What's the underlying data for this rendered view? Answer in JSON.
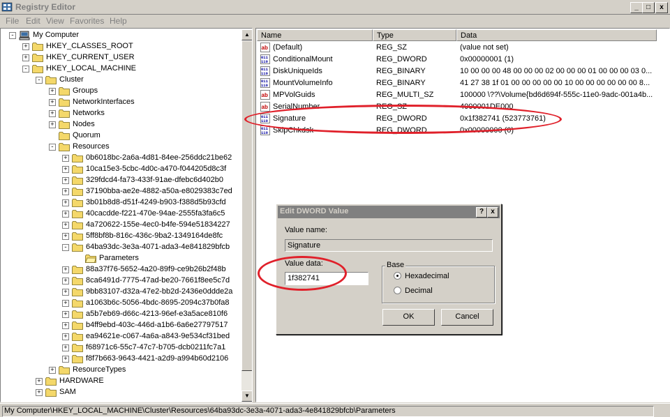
{
  "window": {
    "title": "Registry Editor",
    "min": "_",
    "max": "□",
    "close": "x"
  },
  "menu": [
    "File",
    "Edit",
    "View",
    "Favorites",
    "Help"
  ],
  "tree": [
    {
      "label": "My Computer",
      "level": 0,
      "exp": "-",
      "icon": "computer-icon"
    },
    {
      "label": "HKEY_CLASSES_ROOT",
      "level": 1,
      "exp": "+"
    },
    {
      "label": "HKEY_CURRENT_USER",
      "level": 1,
      "exp": "+"
    },
    {
      "label": "HKEY_LOCAL_MACHINE",
      "level": 1,
      "exp": "-"
    },
    {
      "label": "Cluster",
      "level": 2,
      "exp": "-"
    },
    {
      "label": "Groups",
      "level": 3,
      "exp": "+"
    },
    {
      "label": "NetworkInterfaces",
      "level": 3,
      "exp": "+"
    },
    {
      "label": "Networks",
      "level": 3,
      "exp": "+"
    },
    {
      "label": "Nodes",
      "level": 3,
      "exp": "+"
    },
    {
      "label": "Quorum",
      "level": 3,
      "exp": ""
    },
    {
      "label": "Resources",
      "level": 3,
      "exp": "-"
    },
    {
      "label": "0b6018bc-2a6a-4d81-84ee-256ddc21be62",
      "level": 4,
      "exp": "+"
    },
    {
      "label": "10ca15e3-5cbc-4d0c-a470-f044205d8c3f",
      "level": 4,
      "exp": "+"
    },
    {
      "label": "329fdcd4-fa73-433f-91ae-dfebc6d402b0",
      "level": 4,
      "exp": "+"
    },
    {
      "label": "37190bba-ae2e-4882-a50a-e8029383c7ed",
      "level": 4,
      "exp": "+"
    },
    {
      "label": "3b01b8d8-d51f-4249-b903-f388d5b93cfd",
      "level": 4,
      "exp": "+"
    },
    {
      "label": "40cacdde-f221-470e-94ae-2555fa3fa6c5",
      "level": 4,
      "exp": "+"
    },
    {
      "label": "4a720622-155e-4ec0-b4fe-594e51834227",
      "level": 4,
      "exp": "+"
    },
    {
      "label": "5ff8bf8b-816c-436c-9ba2-1349164de8fc",
      "level": 4,
      "exp": "+"
    },
    {
      "label": "64ba93dc-3e3a-4071-ada3-4e841829bfcb",
      "level": 4,
      "exp": "-"
    },
    {
      "label": "Parameters",
      "level": 5,
      "exp": "",
      "open": true
    },
    {
      "label": "88a37f76-5652-4a20-89f9-ce9b26b2f48b",
      "level": 4,
      "exp": "+"
    },
    {
      "label": "8ca6491d-7775-47ad-be20-7661f8ee5c7d",
      "level": 4,
      "exp": "+"
    },
    {
      "label": "9bb83107-d32a-47e2-bb2d-2436e0ddde2a",
      "level": 4,
      "exp": "+"
    },
    {
      "label": "a1063b6c-5056-4bdc-8695-2094c37b0fa8",
      "level": 4,
      "exp": "+"
    },
    {
      "label": "a5b7eb69-d66c-4213-96ef-e3a5ace810f6",
      "level": 4,
      "exp": "+"
    },
    {
      "label": "b4ff9ebd-403c-446d-a1b6-6a6e27797517",
      "level": 4,
      "exp": "+"
    },
    {
      "label": "ea94621e-c067-4a6a-a843-9e534cf31bed",
      "level": 4,
      "exp": "+"
    },
    {
      "label": "f68971c6-55c7-47c7-b705-dcb0211fc7a1",
      "level": 4,
      "exp": "+"
    },
    {
      "label": "f8f7b663-9643-4421-a2d9-a994b60d2106",
      "level": 4,
      "exp": "+"
    },
    {
      "label": "ResourceTypes",
      "level": 3,
      "exp": "+"
    },
    {
      "label": "HARDWARE",
      "level": 2,
      "exp": "+"
    },
    {
      "label": "SAM",
      "level": 2,
      "exp": "+"
    }
  ],
  "columns": [
    "Name",
    "Type",
    "Data"
  ],
  "values": [
    {
      "name": "(Default)",
      "type": "REG_SZ",
      "data": "(value not set)",
      "kind": "sz"
    },
    {
      "name": "ConditionalMount",
      "type": "REG_DWORD",
      "data": "0x00000001 (1)",
      "kind": "bin"
    },
    {
      "name": "DiskUniqueIds",
      "type": "REG_BINARY",
      "data": "10 00 00 00 48 00 00 00 02 00 00 00 01 00 00 00 03 0...",
      "kind": "bin"
    },
    {
      "name": "MountVolumeInfo",
      "type": "REG_BINARY",
      "data": "41 27 38 1f 01 00 00 00 00 00 10 00 00 00 00 00 00 8...",
      "kind": "bin"
    },
    {
      "name": "MPVolGuids",
      "type": "REG_MULTI_SZ",
      "data": "100000 \\??\\Volume{bd6d694f-555c-11e0-9adc-001a4b...",
      "kind": "sz"
    },
    {
      "name": "SerialNumber",
      "type": "REG_SZ",
      "data": "4000001DE000",
      "kind": "sz"
    },
    {
      "name": "Signature",
      "type": "REG_DWORD",
      "data": "0x1f382741 (523773761)",
      "kind": "bin"
    },
    {
      "name": "SkipChkdsk",
      "type": "REG_DWORD",
      "data": "0x00000000 (0)",
      "kind": "bin"
    }
  ],
  "status": "My Computer\\HKEY_LOCAL_MACHINE\\Cluster\\Resources\\64ba93dc-3e3a-4071-ada3-4e841829bfcb\\Parameters",
  "dialog": {
    "title": "Edit DWORD Value",
    "help": "?",
    "close": "x",
    "value_name_label": "Value name:",
    "value_name": "Signature",
    "value_data_label": "Value data:",
    "value_data": "1f382741",
    "base_label": "Base",
    "hex_label": "Hexadecimal",
    "dec_label": "Decimal",
    "ok": "OK",
    "cancel": "Cancel",
    "selected_base": "Hexadecimal"
  },
  "colors": {
    "annotation": "#e0202a",
    "folder": "#f4d86a"
  }
}
